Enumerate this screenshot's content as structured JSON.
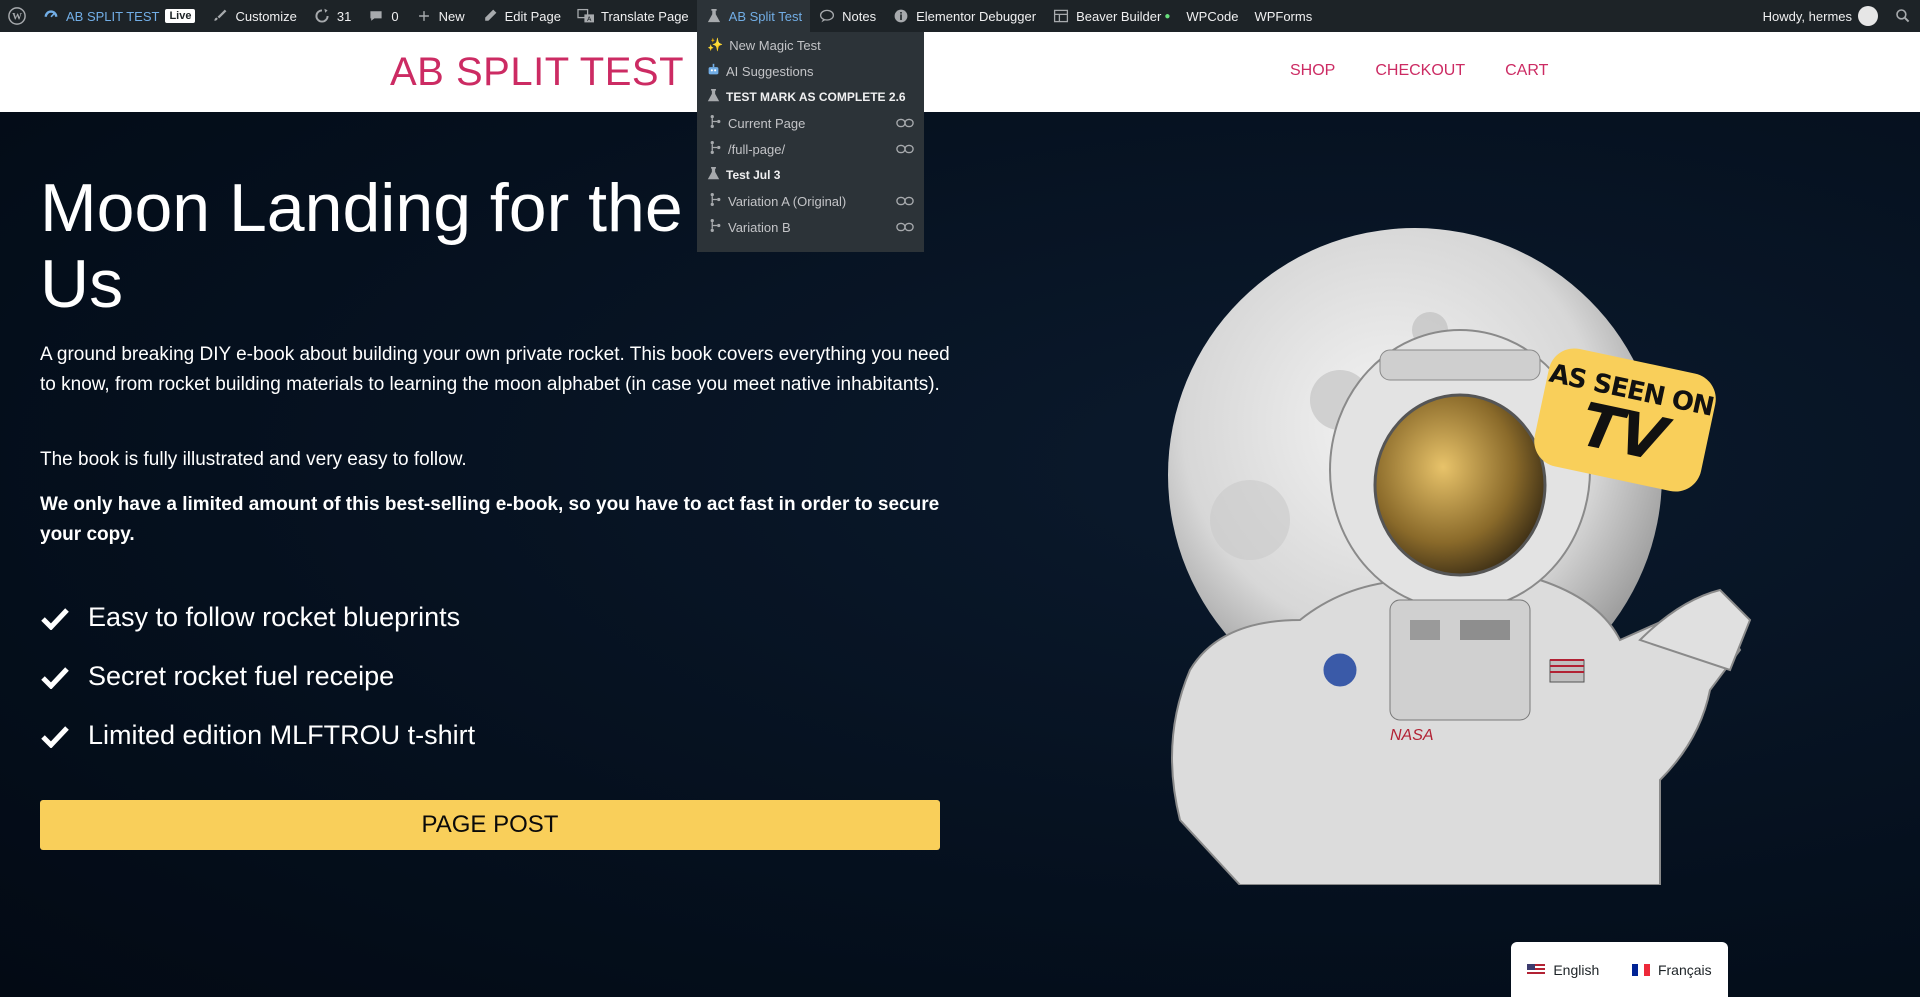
{
  "adminbar": {
    "site_name": "AB SPLIT TEST",
    "live_badge": "Live",
    "customize": "Customize",
    "updates_count": "31",
    "comments_count": "0",
    "new": "New",
    "edit_page": "Edit Page",
    "translate_page": "Translate Page",
    "ab_split_test": "AB Split Test",
    "notes": "Notes",
    "elementor_debugger": "Elementor Debugger",
    "beaver_builder": "Beaver Builder",
    "wpcode": "WPCode",
    "wpforms": "WPForms",
    "greeting": "Howdy, hermes"
  },
  "dropdown": {
    "items": [
      {
        "label": "New Magic Test",
        "icon": "sparkle-icon"
      },
      {
        "label": "AI Suggestions",
        "icon": "robot-icon"
      },
      {
        "label": "TEST MARK AS COMPLETE 2.6",
        "icon": "flask-icon",
        "heading": true
      },
      {
        "label": "Current Page",
        "icon": "branch-icon",
        "link": true
      },
      {
        "label": "/full-page/",
        "icon": "branch-icon",
        "link": true
      },
      {
        "label": "Test Jul 3",
        "icon": "flask-icon",
        "heading": true
      },
      {
        "label": "Variation A (Original)",
        "icon": "branch-icon",
        "link": true
      },
      {
        "label": "Variation B",
        "icon": "branch-icon",
        "link": true
      }
    ]
  },
  "header": {
    "site_title": "AB SPLIT TEST",
    "nav": [
      "SHOP",
      "CHECKOUT",
      "CART"
    ]
  },
  "hero": {
    "title": "Moon Landing for the Rest of Us",
    "p1": "A ground breaking DIY e-book about building your own private rocket. This book covers everything you need to know, from rocket building materials to learning the moon alphabet (in case you meet native inhabitants).",
    "p2": "The book is fully illustrated and very easy to follow.",
    "p3": "We only have a limited amount of this best-selling e-book, so you have to act fast in order to secure your copy.",
    "bullets": [
      "Easy to follow rocket blueprints",
      "Secret rocket fuel receipe",
      "Limited edition MLFTROU t-shirt"
    ],
    "cta": "PAGE POST",
    "badge_line1": "AS SEEN ON",
    "badge_line2": "TV",
    "helmet_text": "NASA"
  },
  "language": {
    "english": "English",
    "french": "Français"
  },
  "colors": {
    "brand": "#cc2b63",
    "cta": "#f9cf5a",
    "adminbar": "#1d2327",
    "hero_bg": "#05101e"
  }
}
